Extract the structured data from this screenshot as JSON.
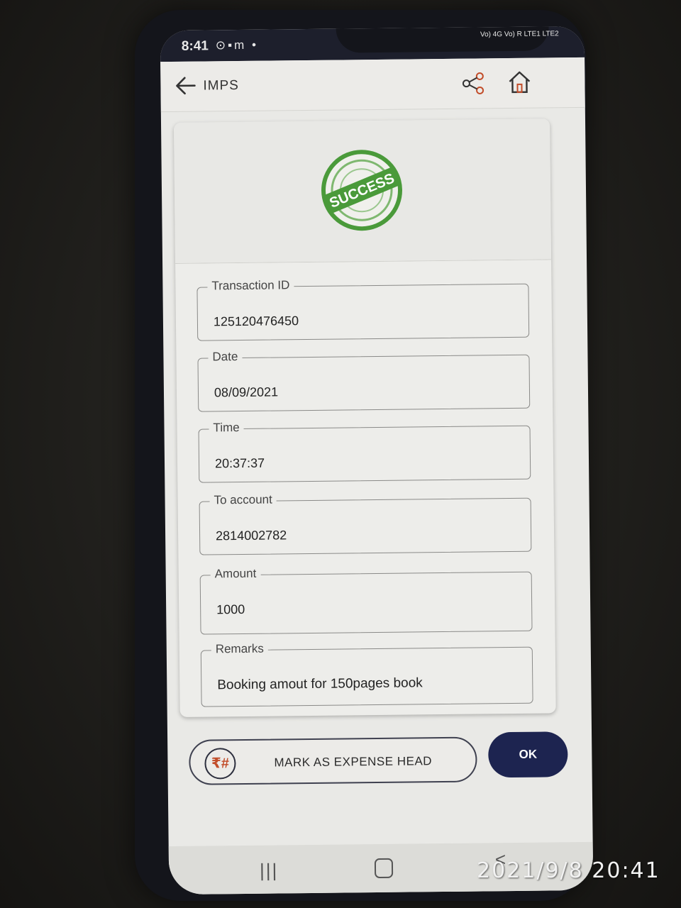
{
  "status_bar": {
    "time": "8:41",
    "notification_icons": "⊙▪m •",
    "right_indicators": "Vo) 4G Vo) R LTE1 LTE2"
  },
  "app_bar": {
    "title": "IMPS",
    "icons": [
      "back-arrow-icon",
      "share-icon",
      "home-icon"
    ]
  },
  "status_stamp": "SUCCESS",
  "fields": [
    {
      "label": "Transaction ID",
      "value": "125120476450"
    },
    {
      "label": "Date",
      "value": "08/09/2021"
    },
    {
      "label": "Time",
      "value": "20:37:37"
    },
    {
      "label": "To account",
      "value": "2814002782"
    },
    {
      "label": "Amount",
      "value": "1000"
    },
    {
      "label": "Remarks",
      "value": "Booking amout for 150pages book"
    }
  ],
  "actions": {
    "expense_label": "MARK AS EXPENSE HEAD",
    "expense_icon": "₹#",
    "ok_label": "OK"
  },
  "nav_bar": {
    "recent": "|||",
    "back": "<"
  },
  "photo_timestamp": "2021/9/8  20:41",
  "colors": {
    "accent_dark_blue": "#1d2450",
    "success_green": "#4a9a3a",
    "rupee_orange": "#c24d2a"
  }
}
